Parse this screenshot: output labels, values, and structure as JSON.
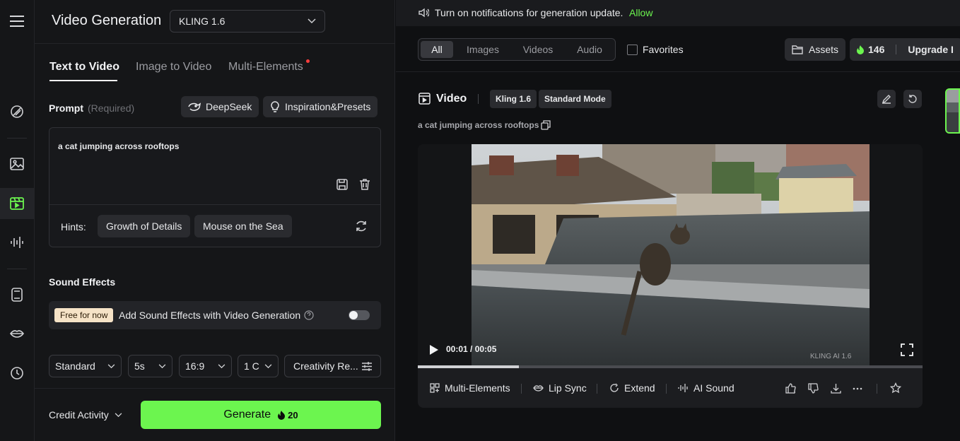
{
  "app": {
    "title": "Video Generation",
    "model": "KLING 1.6"
  },
  "tabs": [
    {
      "label": "Text to Video"
    },
    {
      "label": "Image to Video"
    },
    {
      "label": "Multi-Elements"
    }
  ],
  "prompt": {
    "label": "Prompt",
    "required": "(Required)",
    "deepseek": "DeepSeek",
    "inspiration": "Inspiration&Presets",
    "value": "a cat jumping across rooftops",
    "hints_label": "Hints:",
    "hints": [
      "Growth of Details",
      "Mouse on the Sea"
    ]
  },
  "sound": {
    "heading": "Sound Effects",
    "badge": "Free for now",
    "text": "Add Sound Effects with Video Generation",
    "enabled": false
  },
  "settings": {
    "mode": "Standard",
    "duration": "5s",
    "ratio": "16:9",
    "count": "1 C",
    "creativity": "Creativity Re..."
  },
  "footer": {
    "credit_activity": "Credit Activity",
    "generate": "Generate",
    "cost": "20"
  },
  "notification": {
    "text": "Turn on notifications for generation update.",
    "allow": "Allow"
  },
  "filters": {
    "tabs": [
      "All",
      "Images",
      "Videos",
      "Audio"
    ],
    "active": "All",
    "favorites": "Favorites"
  },
  "top_actions": {
    "assets": "Assets",
    "credits": "146",
    "upgrade": "Upgrade I"
  },
  "result": {
    "type": "Video",
    "model_tag": "Kling 1.6",
    "mode_tag": "Standard Mode",
    "prompt": "a cat jumping across rooftops",
    "time": "00:01 / 00:05",
    "progress_fraction": 0.2,
    "watermark": "KLING AI 1.6",
    "actions": [
      "Multi-Elements",
      "Lip Sync",
      "Extend",
      "AI Sound"
    ]
  },
  "colors": {
    "accent": "#6cf54f",
    "background": "#0f1012",
    "panel": "#151618"
  }
}
